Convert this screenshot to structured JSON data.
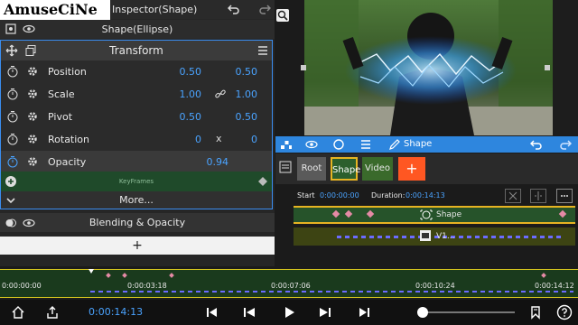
{
  "watermark": "AmuseCiNe",
  "inspector": {
    "title": "Inspector(Shape)",
    "subject": "Shape(Ellipse)",
    "transform_title": "Transform",
    "rows": [
      {
        "label": "Position",
        "v1": "0.50",
        "mid": "",
        "v2": "0.50"
      },
      {
        "label": "Scale",
        "v1": "1.00",
        "mid": "link-icon",
        "v2": "1.00"
      },
      {
        "label": "Pivot",
        "v1": "0.50",
        "mid": "",
        "v2": "0.50"
      },
      {
        "label": "Rotation",
        "v1": "0",
        "mid": "x",
        "v2": "0"
      },
      {
        "label": "Opacity",
        "v1": "0.94",
        "mid": "",
        "v2": ""
      }
    ],
    "keyframes_label": "KeyFrames",
    "more_label": "More...",
    "blending_label": "Blending & Opacity",
    "add_label": "+"
  },
  "timeline": {
    "toolbar_label": "Shape",
    "tabs": {
      "root": "Root",
      "shape": "Shape",
      "video": "Video",
      "add": "+"
    },
    "start_label": "Start",
    "start_value": "0:00:00:00",
    "duration_label": "Duration:",
    "duration_value": "0:00:14:13",
    "shape_track_label": "Shape",
    "video_track_label": "V1..."
  },
  "ruler": {
    "ticks": [
      "0:00:00:00",
      "0:00:03:18",
      "0:00:07:06",
      "0:00:10:24",
      "0:00:14:12"
    ]
  },
  "bottom_bar": {
    "current_time": "0:00:14:13"
  },
  "colors": {
    "accent": "#2e86de",
    "value_blue": "#4aa3ff",
    "track_green": "#26532a",
    "selection_yellow": "#e6b422",
    "add_orange": "#ff5722"
  }
}
